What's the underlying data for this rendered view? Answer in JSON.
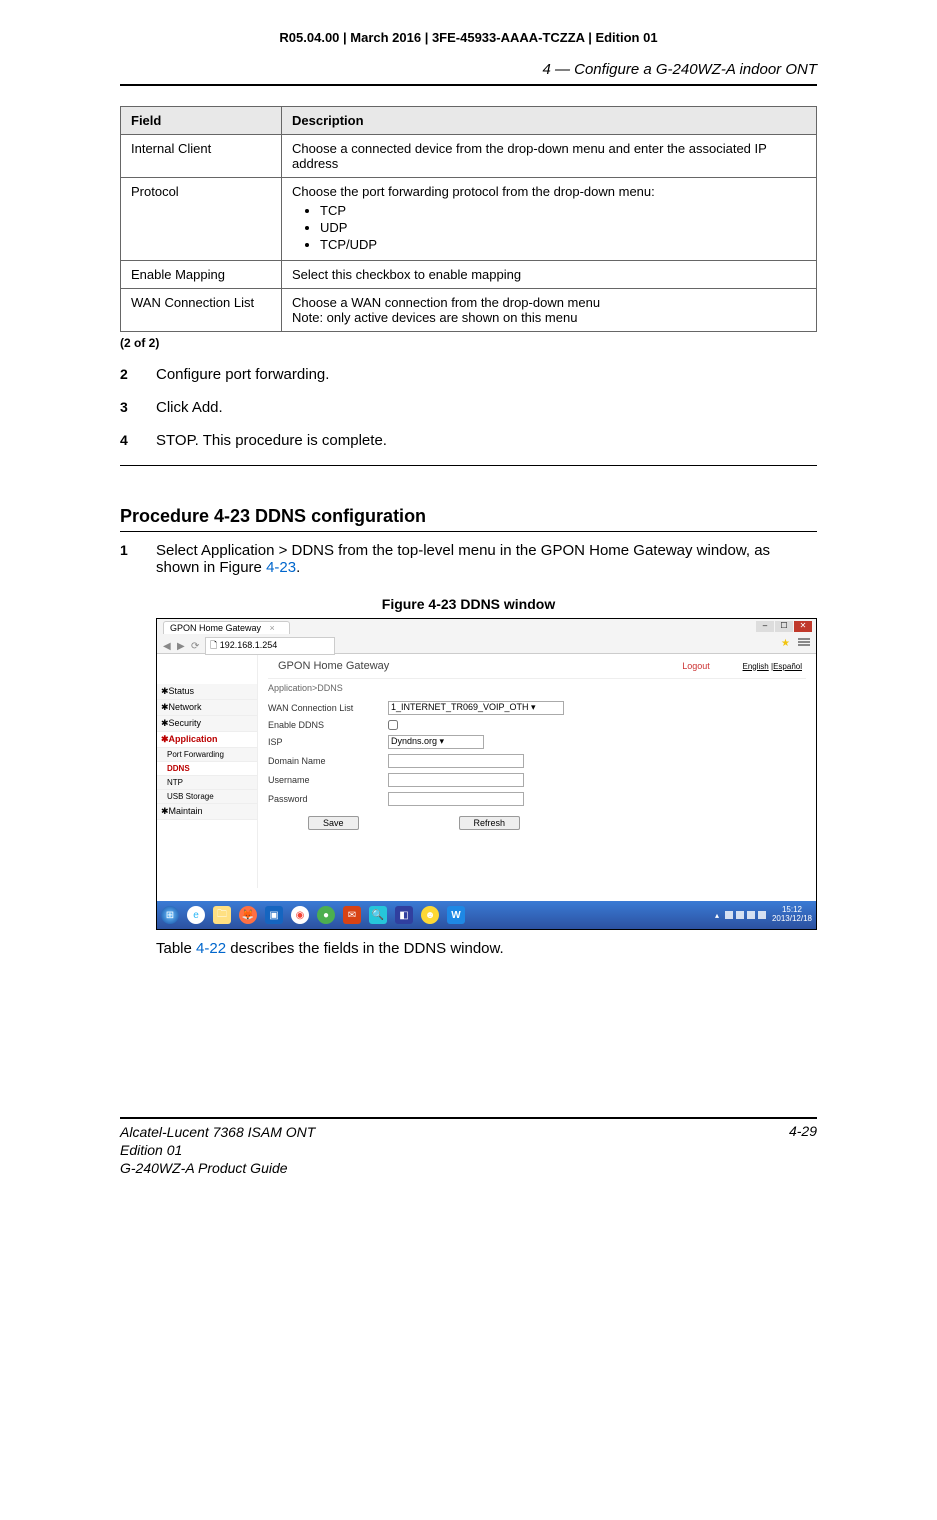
{
  "doc_header": "R05.04.00 | March 2016 | 3FE-45933-AAAA-TCZZA | Edition 01",
  "section_title": "4 —  Configure a G-240WZ-A indoor ONT",
  "table": {
    "header_field": "Field",
    "header_desc": "Description",
    "rows": [
      {
        "field": "Internal Client",
        "desc": "Choose a connected device from the drop-down menu and enter the associated IP address"
      },
      {
        "field": "Protocol",
        "desc": "Choose the port forwarding protocol from the drop-down menu:",
        "items": [
          "TCP",
          "UDP",
          "TCP/UDP"
        ]
      },
      {
        "field": "Enable Mapping",
        "desc": "Select this checkbox to enable mapping"
      },
      {
        "field": "WAN Connection List",
        "desc": "Choose a WAN connection from the drop-down menu",
        "note": "Note: only active devices are shown on this menu"
      }
    ],
    "footer": "(2 of 2)"
  },
  "steps_a": [
    {
      "n": "2",
      "t": "Configure port forwarding."
    },
    {
      "n": "3",
      "t": "Click Add."
    },
    {
      "n": "4",
      "t": "STOP. This procedure is complete."
    }
  ],
  "procedure_heading": "Procedure 4-23  DDNS configuration",
  "step1": {
    "n": "1",
    "t_pre": "Select Application > DDNS from the top-level menu in the GPON Home Gateway window, as shown in Figure ",
    "ref": "4-23",
    "t_post": "."
  },
  "figure_caption": "Figure 4-23  DDNS window",
  "browser": {
    "tab": "GPON Home Gateway",
    "url": "192.168.1.254"
  },
  "gateway": {
    "title": "GPON Home Gateway",
    "logout": "Logout",
    "lang1": "English",
    "lang2": "Español",
    "breadcrumb": "Application>DDNS",
    "sidebar": {
      "status": "Status",
      "network": "Network",
      "security": "Security",
      "application": "Application",
      "port_forwarding": "Port Forwarding",
      "ddns": "DDNS",
      "ntp": "NTP",
      "usb": "USB Storage",
      "maintain": "Maintain"
    },
    "form": {
      "wan_label": "WAN Connection List",
      "wan_value": "1_INTERNET_TR069_VOIP_OTH",
      "enable_label": "Enable DDNS",
      "isp_label": "ISP",
      "isp_value": "Dyndns.org",
      "domain_label": "Domain Name",
      "user_label": "Username",
      "pass_label": "Password",
      "save": "Save",
      "refresh": "Refresh"
    }
  },
  "taskbar": {
    "time": "15:12",
    "date": "2013/12/18",
    "word": "W"
  },
  "post_figure": {
    "pre": "Table ",
    "ref": "4-22",
    "post": " describes the fields in the DDNS window."
  },
  "footer": {
    "l1": "Alcatel-Lucent 7368 ISAM ONT",
    "l2": "Edition 01",
    "l3": "G-240WZ-A Product Guide",
    "page": "4-29"
  }
}
